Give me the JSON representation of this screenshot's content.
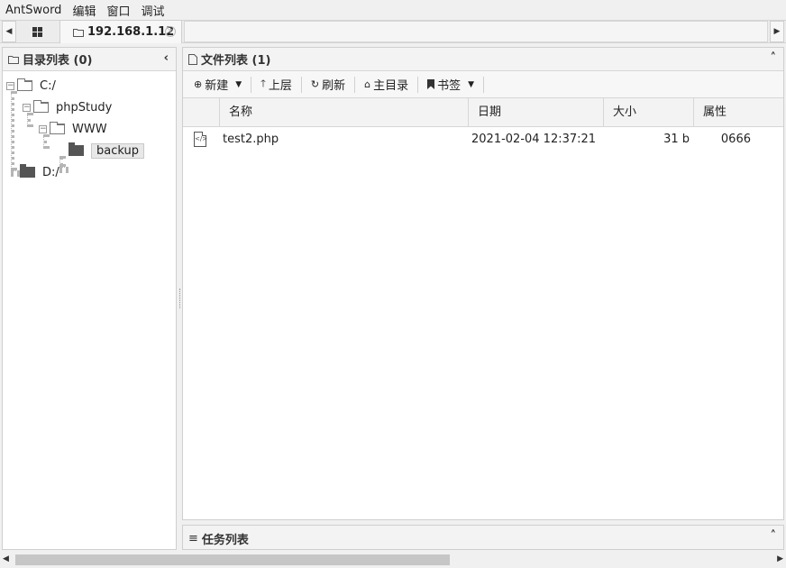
{
  "menubar": {
    "items": [
      "AntSword",
      "编辑",
      "窗口",
      "调试"
    ]
  },
  "tabs": {
    "active_label": "192.168.1.12"
  },
  "directory_panel": {
    "title": "目录列表 (0)",
    "tree": [
      {
        "label": "C:/",
        "expanded": true
      },
      {
        "label": "phpStudy",
        "expanded": true
      },
      {
        "label": "WWW",
        "expanded": true
      },
      {
        "label": "backup",
        "selected": true
      },
      {
        "label": "D:/",
        "expanded": false
      }
    ]
  },
  "file_panel": {
    "title": "文件列表 (1)",
    "toolbar": {
      "new": "新建",
      "up": "上层",
      "refresh": "刷新",
      "home": "主目录",
      "bookmark": "书签"
    },
    "columns": {
      "name": "名称",
      "date": "日期",
      "size": "大小",
      "attr": "属性"
    },
    "rows": [
      {
        "name": "test2.php",
        "date": "2021-02-04 12:37:21",
        "size": "31 b",
        "attr": "0666"
      }
    ]
  },
  "task_panel": {
    "title": "任务列表"
  },
  "colors": {
    "background": "#f0f0f0",
    "panel_header": "#f3f3f3",
    "border": "#cfcfcf"
  }
}
